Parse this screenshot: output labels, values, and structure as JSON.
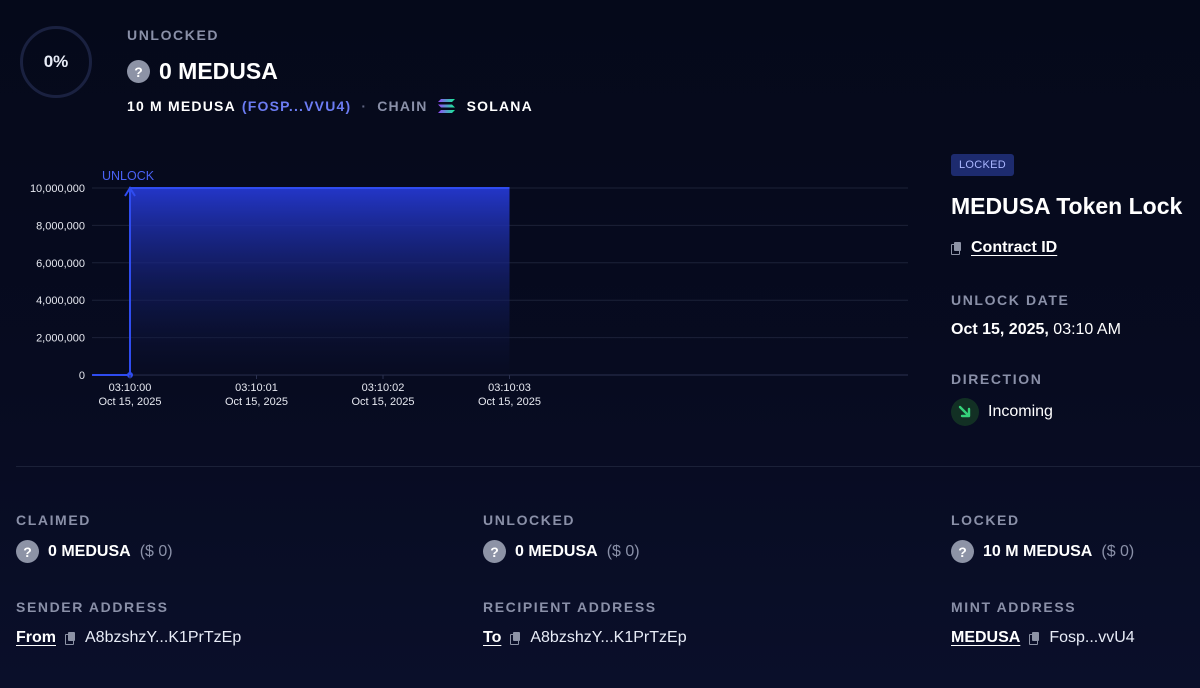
{
  "header": {
    "percent": "0%",
    "unlocked_label": "UNLOCKED",
    "unlocked_amount": "0 MEDUSA",
    "total": "10 M MEDUSA",
    "token_address": "(FOSP...VVU4)",
    "chain_label": "CHAIN",
    "chain_name": "SOLANA"
  },
  "chart_data": {
    "type": "area",
    "annotation": "UNLOCK",
    "x": [
      "03:10:00\nOct 15, 2025",
      "03:10:01\nOct 15, 2025",
      "03:10:02\nOct 15, 2025",
      "03:10:03\nOct 15, 2025"
    ],
    "x_ticks": [
      {
        "time": "03:10:00",
        "date": "Oct 15, 2025"
      },
      {
        "time": "03:10:01",
        "date": "Oct 15, 2025"
      },
      {
        "time": "03:10:02",
        "date": "Oct 15, 2025"
      },
      {
        "time": "03:10:03",
        "date": "Oct 15, 2025"
      }
    ],
    "y_ticks": [
      "0",
      "2,000,000",
      "4,000,000",
      "6,000,000",
      "8,000,000",
      "10,000,000"
    ],
    "ylim": [
      0,
      10000000
    ],
    "series": [
      {
        "values": [
          [
            -0.3,
            0
          ],
          [
            0,
            0
          ],
          [
            0,
            10000000
          ],
          [
            3,
            10000000
          ]
        ]
      }
    ],
    "grid": true,
    "colors": {
      "line": "#2f4cf0",
      "fill_top": "#2336c8",
      "fill_bottom": "#0a0f2a"
    }
  },
  "panel": {
    "badge": "LOCKED",
    "title": "MEDUSA Token Lock",
    "contract_label": "Contract ID",
    "unlock_date_label": "UNLOCK DATE",
    "unlock_date": "Oct 15, 2025,",
    "unlock_time": " 03:10 AM",
    "direction_label": "DIRECTION",
    "direction_value": "Incoming"
  },
  "stats": {
    "claimed": {
      "label": "CLAIMED",
      "amount": "0 MEDUSA",
      "usd": "($ 0)"
    },
    "unlocked": {
      "label": "UNLOCKED",
      "amount": "0 MEDUSA",
      "usd": "($ 0)"
    },
    "locked": {
      "label": "LOCKED",
      "amount": "10 M MEDUSA",
      "usd": "($ 0)"
    }
  },
  "addresses": {
    "sender": {
      "label": "SENDER ADDRESS",
      "link": "From",
      "value": "A8bzshzY...K1PrTzEp"
    },
    "recipient": {
      "label": "RECIPIENT ADDRESS",
      "link": "To",
      "value": "A8bzshzY...K1PrTzEp"
    },
    "mint": {
      "label": "MINT ADDRESS",
      "link": "MEDUSA",
      "value": "Fosp...vvU4"
    }
  },
  "colors": {
    "accent": "#6c7cf3",
    "positive": "#35d27a",
    "muted": "#8a90a8",
    "badge_bg": "#1d2b6e"
  }
}
